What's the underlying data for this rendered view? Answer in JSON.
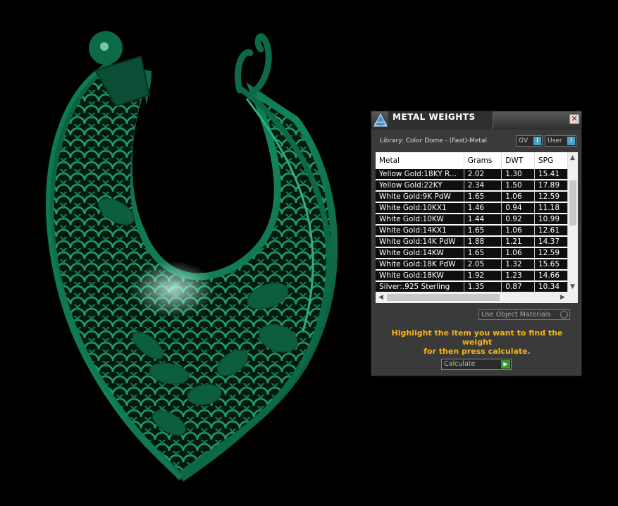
{
  "panel": {
    "title": "METAL WEIGHTS",
    "close_label": "✕",
    "library": "Library: Color Dome - (Fast)-Metal",
    "gv_label": "GV",
    "user_label": "User",
    "toggle_knob": "I",
    "use_object_materials": "Use Object Materials",
    "hint_line1": "Highlight the item you want to find the weight",
    "hint_line2": "for then press calculate.",
    "calculate_label": "Calculate",
    "calculate_icon": "play-icon"
  },
  "table": {
    "columns": [
      "Metal",
      "Grams",
      "DWT",
      "SPG"
    ],
    "rows": [
      [
        "Yellow Gold:18KY R...",
        "2.02",
        "1.30",
        "15.41"
      ],
      [
        "Yellow Gold:22KY",
        "2.34",
        "1.50",
        "17.89"
      ],
      [
        "White Gold:9K PdW",
        "1.65",
        "1.06",
        "12.59"
      ],
      [
        "White Gold:10KX1",
        "1.46",
        "0.94",
        "11.18"
      ],
      [
        "White Gold:10KW",
        "1.44",
        "0.92",
        "10.99"
      ],
      [
        "White Gold:14KX1",
        "1.65",
        "1.06",
        "12.61"
      ],
      [
        "White Gold:14K PdW",
        "1.88",
        "1.21",
        "14.37"
      ],
      [
        "White Gold:14KW",
        "1.65",
        "1.06",
        "12.59"
      ],
      [
        "White Gold:18K PdW",
        "2.05",
        "1.32",
        "15.65"
      ],
      [
        "White Gold:18KW",
        "1.92",
        "1.23",
        "14.66"
      ],
      [
        "Silver:.925 Sterling",
        "1.35",
        "0.87",
        "10.34"
      ]
    ]
  },
  "colors": {
    "model_green": "#0d6a47",
    "hint_orange": "#f5b319",
    "knob_blue": "#4ba3c9"
  }
}
